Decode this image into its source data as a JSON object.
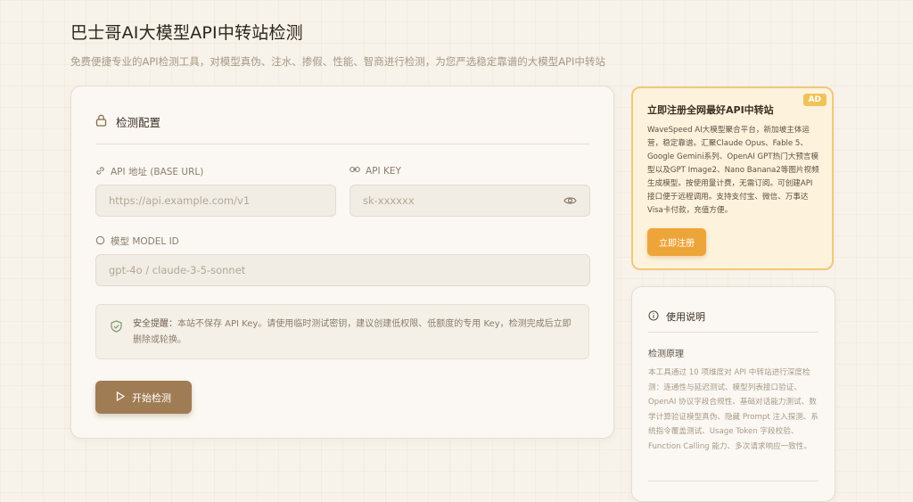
{
  "header": {
    "title": "巴士哥AI大模型API中转站检测",
    "subtitle": "免费便捷专业的API检测工具，对模型真伪、注水、掺假、性能、智商进行检测，为您严选稳定靠谱的大模型API中转站"
  },
  "config": {
    "title": "检测配置",
    "base_url_label": "API 地址 (BASE URL)",
    "base_url_placeholder": "https://api.example.com/v1",
    "api_key_label": "API KEY",
    "api_key_placeholder": "sk-xxxxxx",
    "model_label": "模型 MODEL ID",
    "model_placeholder": "gpt-4o / claude-3-5-sonnet",
    "notice_prefix": "安全提醒：",
    "notice_text": "本站不保存 API Key。请使用临时测试密钥，建议创建低权限、低额度的专用 Key，检测完成后立即删除或轮换。",
    "start_button": "开始检测"
  },
  "ad": {
    "badge": "AD",
    "title": "立即注册全网最好API中转站",
    "body": "WaveSpeed AI大模型聚合平台，新加坡主体运营，稳定靠谱。汇聚Claude Opus、Fable 5、Google Gemini系列、OpenAI GPT热门大预言模型以及GPT Image2、Nano Banana2等图片视频生成模型。按使用量计费，无需订阅。可创建API接口便于远程调用。支持支付宝、微信、万事达Visa卡付款，充值方便。",
    "button": "立即注册"
  },
  "usage": {
    "title": "使用说明",
    "subtitle": "检测原理",
    "body": "本工具通过 10 项维度对 API 中转站进行深度检测：连通性与延迟测试、模型列表接口验证、OpenAI 协议字段合规性、基础对话能力测试、数学计算验证模型真伪、隐藏 Prompt 注入探测、系统指令覆盖测试、Usage Token 字段校验、Function Calling 能力、多次请求响应一致性。"
  },
  "colors": {
    "primary_button": "#a07c55",
    "ad_button": "#eda53a",
    "ad_border": "#f0c879",
    "background": "#f7f2ea"
  },
  "icons": [
    "lock-icon",
    "link-icon",
    "key-link-icon",
    "eye-icon",
    "circle-icon",
    "shield-check-icon",
    "play-icon",
    "info-icon"
  ]
}
